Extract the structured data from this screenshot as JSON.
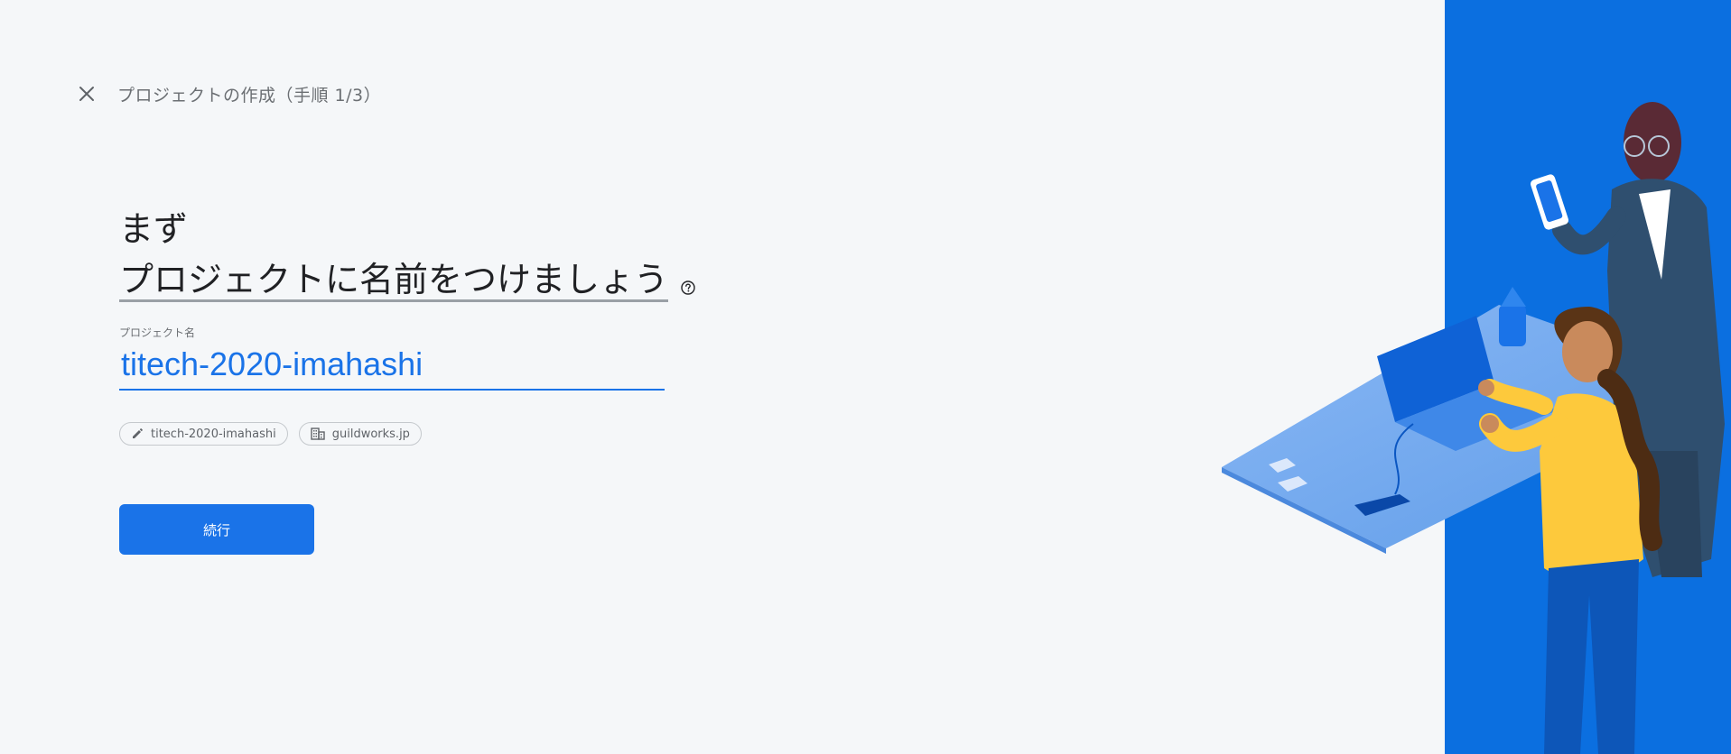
{
  "header": {
    "step_title": "プロジェクトの作成（手順 1/3）"
  },
  "hero": {
    "line1": "まず",
    "line2": "プロジェクトに名前をつけましょう"
  },
  "form": {
    "label": "プロジェクト名",
    "value": "titech-2020-imahashi"
  },
  "chips": {
    "project_id": "titech-2020-imahashi",
    "organization": "guildworks.jp"
  },
  "actions": {
    "continue_label": "続行"
  },
  "icons": {
    "close": "close-icon",
    "help": "help-icon",
    "pencil": "pencil-icon",
    "building": "building-icon"
  },
  "colors": {
    "accent": "#1a73e8",
    "illustration_bg": "#0b6fe0",
    "background": "#f5f7f9"
  }
}
